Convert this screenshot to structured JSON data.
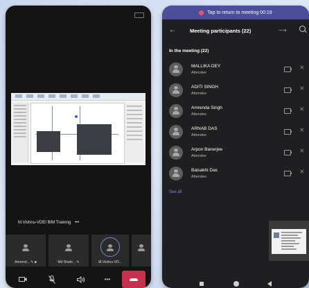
{
  "left_phone": {
    "meeting_label": "M.Vishnu-VDEI BIM Training",
    "more_glyph": "•••",
    "tiles": [
      {
        "name": "Amrend... ✎ ■"
      },
      {
        "name": "Md Shahr... ✎"
      },
      {
        "name": "M.Vishnu-VD..."
      }
    ],
    "controls": {
      "camera_icon": "camera-off-icon",
      "mic_icon": "mic-off-icon",
      "speaker_icon": "speaker-icon",
      "more_label": "•••",
      "hangup_icon": "hang-up-icon"
    }
  },
  "right_phone": {
    "banner_text": "Tap to return to meeting 00:19",
    "title": "Meeting participants (22)",
    "section_label": "In the meeting (22)",
    "participants": [
      {
        "name": "MALLIKA DEY",
        "role": "Attendee"
      },
      {
        "name": "ADITI SINGH",
        "role": "Attendee"
      },
      {
        "name": "Amrenda Singh",
        "role": "Attendee"
      },
      {
        "name": "ARNAB DAS",
        "role": "Attendee"
      },
      {
        "name": "Arpon Banerjee",
        "role": "Attendee"
      },
      {
        "name": "Baisakhi Das",
        "role": "Attendee"
      }
    ],
    "see_all": "See all"
  },
  "colors": {
    "banner": "#4b4e9a",
    "hangup": "#c4314b",
    "link": "#7b83eb"
  }
}
